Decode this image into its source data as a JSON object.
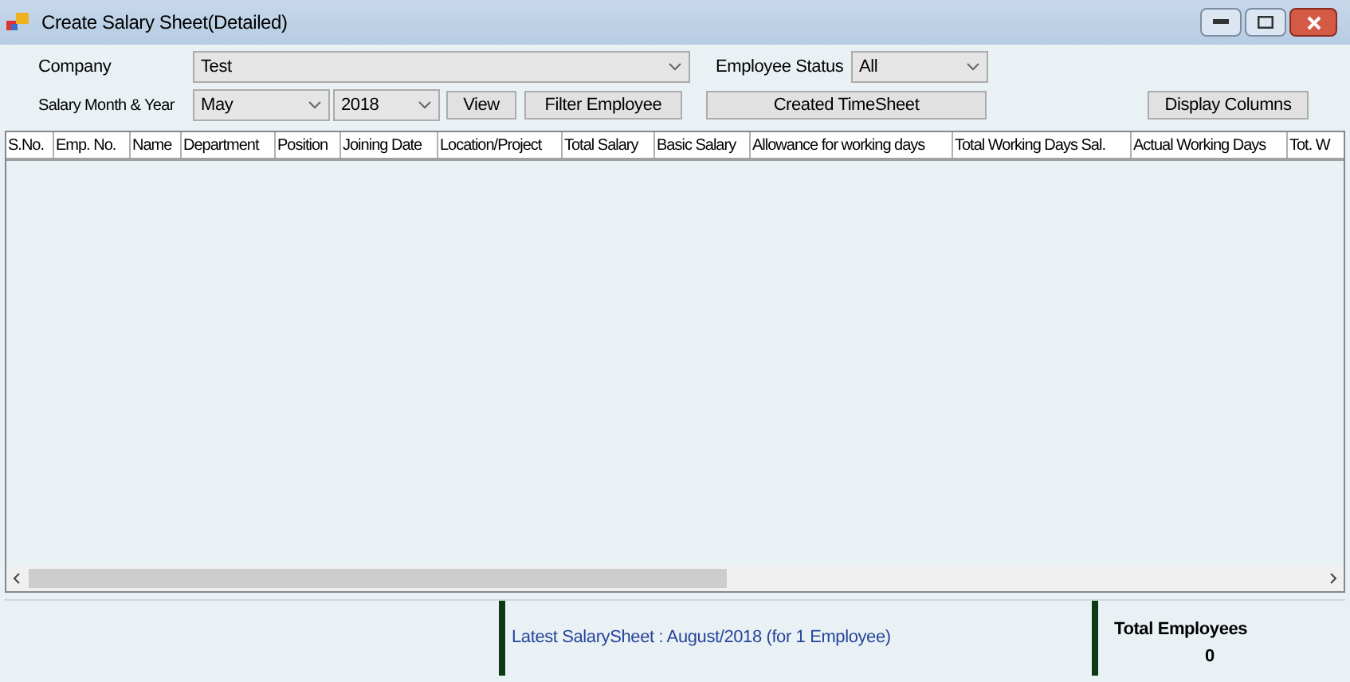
{
  "window": {
    "title": "Create Salary Sheet(Detailed)"
  },
  "company": {
    "label": "Company",
    "value": "Test"
  },
  "employee_status": {
    "label": "Employee Status",
    "value": "All"
  },
  "salary_period": {
    "label": "Salary Month & Year",
    "month": "May",
    "year": "2018"
  },
  "buttons": {
    "view": "View",
    "filter": "Filter Employee",
    "created": "Created TimeSheet",
    "display": "Display Columns"
  },
  "table": {
    "columns": [
      "S.No.",
      "Emp. No.",
      "Name",
      "Department",
      "Position",
      "Joining Date",
      "Location/Project",
      "Total Salary",
      "Basic Salary",
      "Allowance for working days",
      "Total Working Days Sal.",
      "Actual Working Days",
      "Tot. W"
    ]
  },
  "status_bar": {
    "latest": "Latest SalarySheet : August/2018 (for 1 Employee)",
    "total_label": "Total Employees",
    "total_value": "0"
  }
}
